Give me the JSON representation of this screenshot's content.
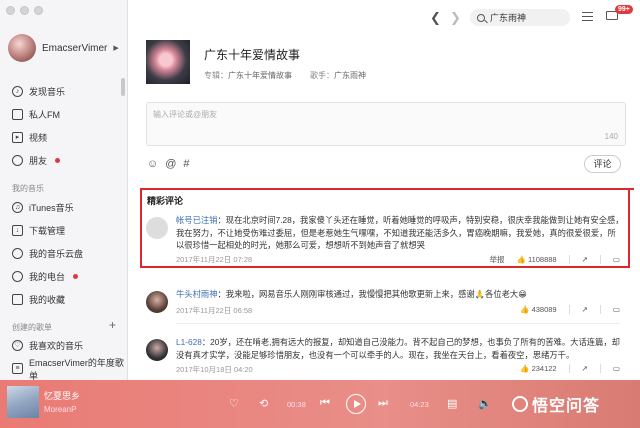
{
  "sidebar": {
    "username": "EmacserVimer",
    "items_top": [
      {
        "label": "发现音乐",
        "icon": "music-disc-icon"
      },
      {
        "label": "私人FM",
        "icon": "radio-icon"
      },
      {
        "label": "视频",
        "icon": "video-icon"
      },
      {
        "label": "朋友",
        "icon": "friends-icon",
        "dot": true
      }
    ],
    "my_music_title": "我的音乐",
    "items_music": [
      {
        "label": "iTunes音乐",
        "icon": "itunes-icon"
      },
      {
        "label": "下载管理",
        "icon": "download-icon"
      },
      {
        "label": "我的音乐云盘",
        "icon": "cloud-icon"
      },
      {
        "label": "我的电台",
        "icon": "podcast-icon",
        "dot": true
      },
      {
        "label": "我的收藏",
        "icon": "star-icon"
      }
    ],
    "created_title": "创建的歌单",
    "items_playlists": [
      {
        "label": "我喜欢的音乐",
        "icon": "heart-icon"
      },
      {
        "label": "EmacserVimer的年度歌单",
        "icon": "playlist-icon"
      }
    ]
  },
  "topbar": {
    "search_value": "广东雨神",
    "mail_badge": "99+"
  },
  "song": {
    "title": "广东十年爱情故事",
    "album_label": "专辑：",
    "album": "广东十年爱情故事",
    "artist_label": "歌手：",
    "artist": "广东雨神"
  },
  "comment_input": {
    "placeholder": "输入评论或@朋友",
    "remaining": "140",
    "submit": "评论"
  },
  "hot_title": "精彩评论",
  "comments": [
    {
      "user": "帐号已注销",
      "text": "：现在北京时间7.28，我家傻丫头还在睡觉，听着她睡觉的呼吸声，特别安稳，很庆幸我能做到让她有安全感，我在努力，不让她受伤难过委屈，但是老惹她生气嘿嘿，不知道我还能活多久，胃癌晚期嘛，我爱她，真的很爱很爱，所以很珍惜一起相处的时光，她那么可爱，想想听不到她声音了就想哭",
      "time": "2017年11月22日 07:28",
      "report": "举报",
      "likes": "1108888"
    },
    {
      "user": "牛头村雨神",
      "text": "：我来啦，网易音乐人刚刚审核通过，我慢慢把其他歌更新上来，感谢🙏各位老大😁",
      "time": "2017年11月22日 06:58",
      "report": "",
      "likes": "438089"
    },
    {
      "user": "L1-628",
      "text": "：20岁，还在啃老,拥有远大的报复，却知道自己没能力。背不起自己的梦想，也事负了所有的苦难。大话连篇，却没有真才实学，没能足够珍惜朋友，也没有一个可以牵手的人。现在，我坐在天台上，看着夜空，思绪万千。",
      "time": "2017年10月18日 04:20",
      "report": "",
      "likes": "234122"
    }
  ],
  "player": {
    "song": "忆夏思乡",
    "artist": "MoreanP",
    "elapsed": "00:38",
    "total": "04:23"
  },
  "watermark": "悟空问答",
  "colors": {
    "accent": "#e0393e",
    "highlight": "#d9282f",
    "player": "#e98a84",
    "user_link": "#3e6fb3"
  }
}
